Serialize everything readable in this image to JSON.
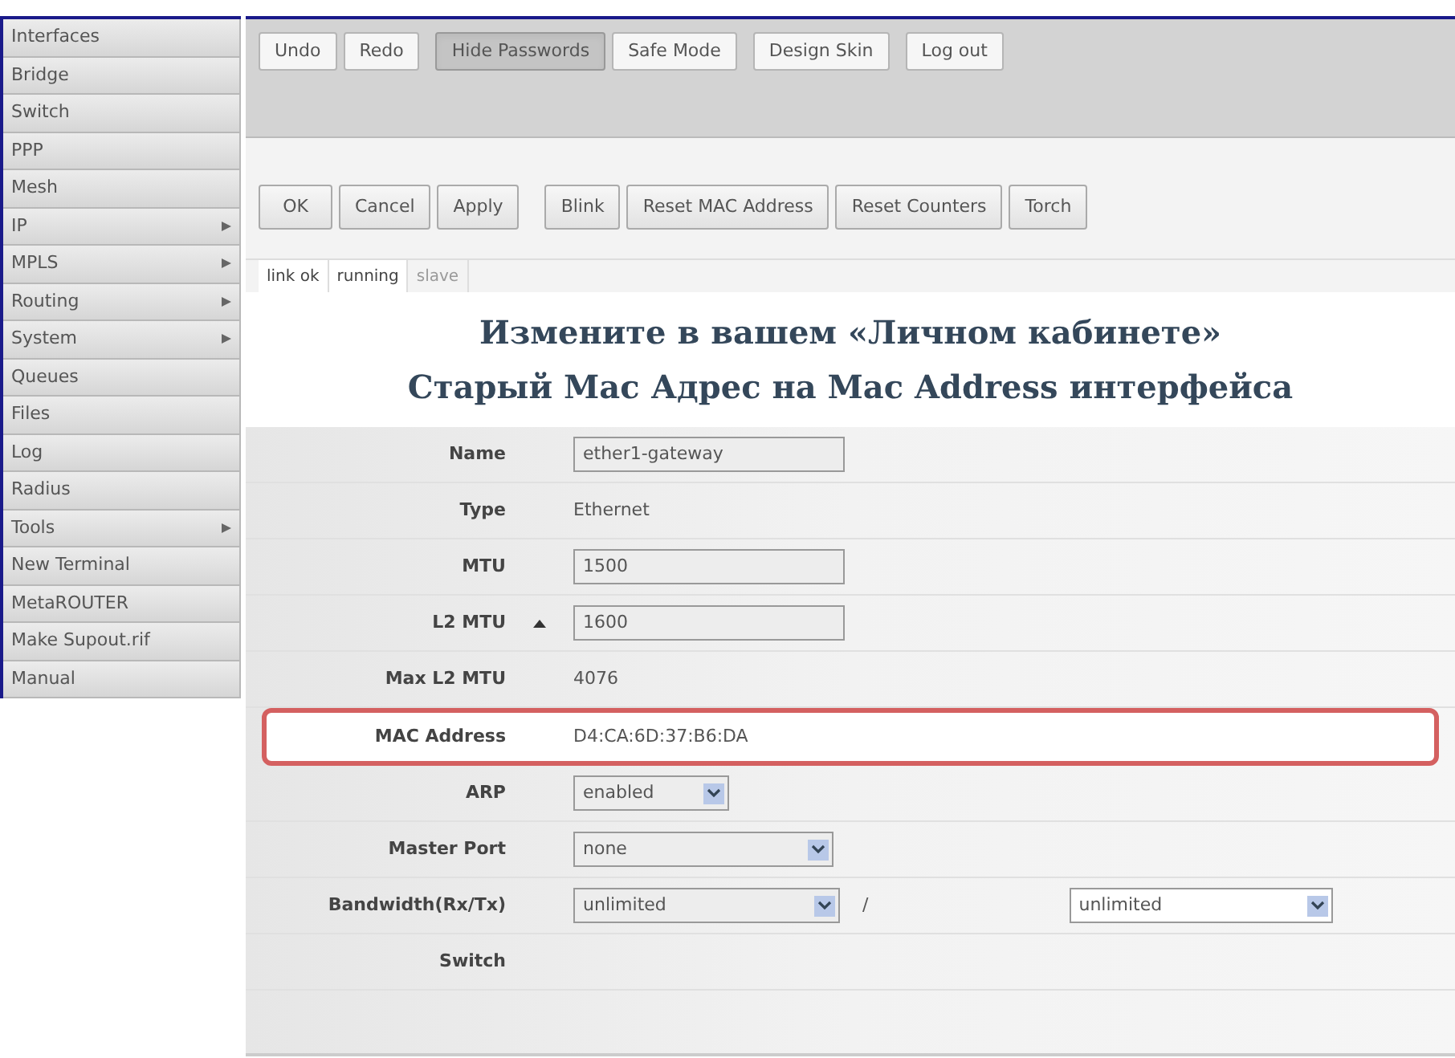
{
  "sidebar": {
    "items": [
      {
        "label": "Interfaces",
        "has_submenu": false
      },
      {
        "label": "Bridge",
        "has_submenu": false
      },
      {
        "label": "Switch",
        "has_submenu": false
      },
      {
        "label": "PPP",
        "has_submenu": false
      },
      {
        "label": "Mesh",
        "has_submenu": false
      },
      {
        "label": "IP",
        "has_submenu": true
      },
      {
        "label": "MPLS",
        "has_submenu": true
      },
      {
        "label": "Routing",
        "has_submenu": true
      },
      {
        "label": "System",
        "has_submenu": true
      },
      {
        "label": "Queues",
        "has_submenu": false
      },
      {
        "label": "Files",
        "has_submenu": false
      },
      {
        "label": "Log",
        "has_submenu": false
      },
      {
        "label": "Radius",
        "has_submenu": false
      },
      {
        "label": "Tools",
        "has_submenu": true
      },
      {
        "label": "New Terminal",
        "has_submenu": false
      },
      {
        "label": "MetaROUTER",
        "has_submenu": false
      },
      {
        "label": "Make Supout.rif",
        "has_submenu": false
      },
      {
        "label": "Manual",
        "has_submenu": false
      }
    ]
  },
  "toolbar": {
    "groups": [
      [
        {
          "label": "Undo",
          "pressed": false
        },
        {
          "label": "Redo",
          "pressed": false
        }
      ],
      [
        {
          "label": "Hide Passwords",
          "pressed": true
        },
        {
          "label": "Safe Mode",
          "pressed": false
        }
      ],
      [
        {
          "label": "Design Skin",
          "pressed": false
        }
      ],
      [
        {
          "label": "Log out",
          "pressed": false
        }
      ]
    ]
  },
  "actions": {
    "groups": [
      [
        "OK",
        "Cancel",
        "Apply"
      ],
      [
        "Blink",
        "Reset MAC Address",
        "Reset Counters",
        "Torch"
      ]
    ]
  },
  "status_tabs": [
    {
      "label": "link ok",
      "active": true
    },
    {
      "label": "running",
      "active": true
    },
    {
      "label": "slave",
      "active": false
    }
  ],
  "overlay_heading": [
    "Измените в вашем «Личном кабинете»",
    "Старый Mac Адрес на Mac Address интерфейса"
  ],
  "form": {
    "rows": [
      {
        "label": "Name",
        "kind": "input",
        "value": "ether1-gateway"
      },
      {
        "label": "Type",
        "kind": "text",
        "value": "Ethernet"
      },
      {
        "label": "MTU",
        "kind": "input",
        "value": "1500"
      },
      {
        "label": "L2 MTU",
        "kind": "input",
        "value": "1600",
        "collapse_arrow": true
      },
      {
        "label": "Max L2 MTU",
        "kind": "text",
        "value": "4076"
      },
      {
        "label": "MAC Address",
        "kind": "text",
        "value": "D4:CA:6D:37:B6:DA",
        "highlighted": true
      },
      {
        "label": "ARP",
        "kind": "select_short",
        "value": "enabled"
      },
      {
        "label": "Master Port",
        "kind": "select",
        "value": "none"
      },
      {
        "label": "Bandwidth(Rx/Tx)",
        "kind": "select_pair",
        "value": "unlimited",
        "separator": "/",
        "value_2": "unlimited"
      },
      {
        "label": "Switch",
        "kind": "empty"
      }
    ]
  }
}
